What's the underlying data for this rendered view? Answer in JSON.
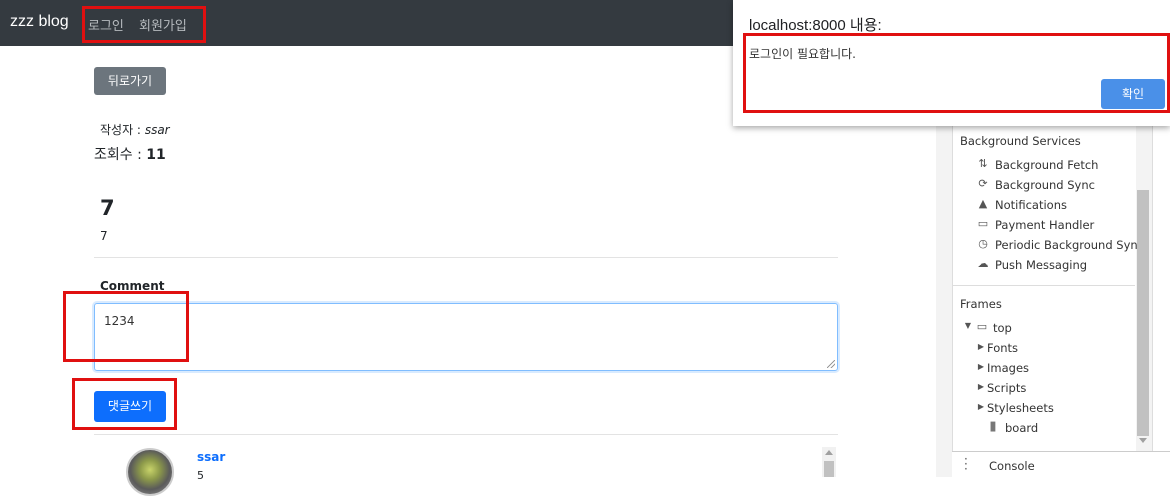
{
  "navbar": {
    "brand": "zzz blog",
    "links": [
      "로그인",
      "회원가입"
    ]
  },
  "post": {
    "back_label": "뒤로가기",
    "author_label": "작성자 :",
    "author_name": "ssar",
    "views_label": "조회수 :",
    "views_count": "11",
    "title": "7",
    "body": "7"
  },
  "comment_form": {
    "label": "Comment",
    "value": "1234",
    "submit_label": "댓글쓰기"
  },
  "comments": [
    {
      "user": "ssar",
      "text": "5"
    }
  ],
  "devtools": {
    "section_background": "Background Services",
    "background_items": [
      {
        "icon": "fetch-arrows-icon",
        "label": "Background Fetch"
      },
      {
        "icon": "sync-icon",
        "label": "Background Sync"
      },
      {
        "icon": "bell-icon",
        "label": "Notifications"
      },
      {
        "icon": "card-icon",
        "label": "Payment Handler"
      },
      {
        "icon": "clock-icon",
        "label": "Periodic Background Sync"
      },
      {
        "icon": "cloud-icon",
        "label": "Push Messaging"
      }
    ],
    "section_frames": "Frames",
    "frame_top": "top",
    "frame_children": [
      "Fonts",
      "Images",
      "Scripts",
      "Stylesheets"
    ],
    "frame_board": "board",
    "console_label": "Console"
  },
  "dialog": {
    "title": "localhost:8000 내용:",
    "message": "로그인이 필요합니다.",
    "ok_label": "확인"
  },
  "colors": {
    "navbar": "#343a40",
    "primary": "#0d6efd",
    "secondary": "#6c757d",
    "highlight_box": "#e01010",
    "dialog_button": "#4a90e8"
  }
}
